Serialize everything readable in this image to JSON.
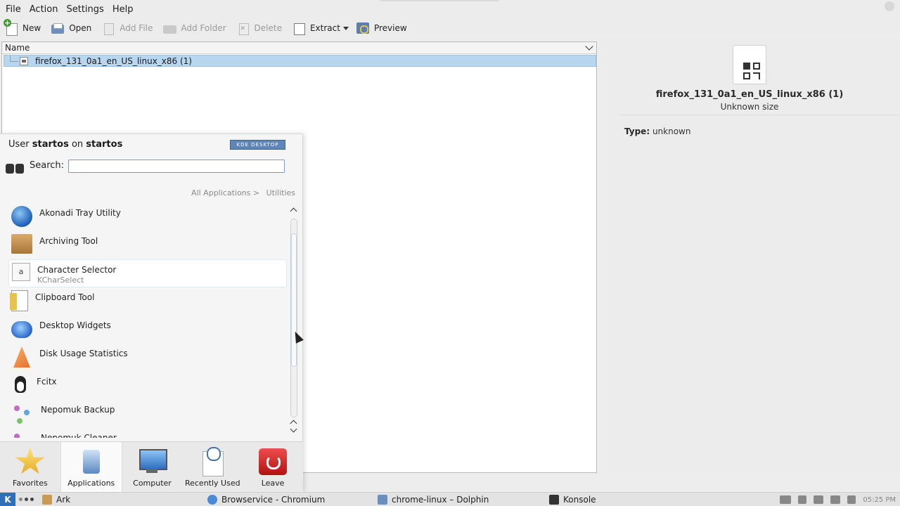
{
  "menubar": {
    "items": [
      "File",
      "Action",
      "Settings",
      "Help"
    ]
  },
  "toolbar": {
    "new": "New",
    "open": "Open",
    "add_file": "Add File",
    "add_folder": "Add Folder",
    "delete": "Delete",
    "extract": "Extract",
    "preview": "Preview"
  },
  "filelist": {
    "column_name": "Name",
    "rows": [
      {
        "name": "firefox_131_0a1_en_US_linux_x86 (1)"
      }
    ]
  },
  "info": {
    "title": "firefox_131_0a1_en_US_linux_x86 (1)",
    "size": "Unknown size",
    "type_label": "Type:",
    "type_value": "unknown"
  },
  "kickoff": {
    "user_prefix": "User",
    "user": "startos",
    "on": "on",
    "host": "startos",
    "badge": "KDE DESKTOP",
    "search_label": "Search:",
    "search_value": "",
    "crumb_root": "All Applications >",
    "crumb_current": "Utilities",
    "apps": [
      {
        "name": "Akonadi Tray Utility",
        "icon": "globe-icon"
      },
      {
        "name": "Archiving Tool",
        "icon": "box-icon"
      },
      {
        "name": "Character Selector",
        "sub": "KCharSelect",
        "icon": "char-icon"
      },
      {
        "name": "Clipboard Tool",
        "icon": "clipboard-icon"
      },
      {
        "name": "Desktop Widgets",
        "icon": "widgets-icon"
      },
      {
        "name": "Disk Usage Statistics",
        "icon": "disk-usage-icon"
      },
      {
        "name": "Fcitx",
        "icon": "penguin-icon"
      },
      {
        "name": "Nepomuk Backup",
        "icon": "nepomuk-icon"
      },
      {
        "name": "Nepomuk Cleaner",
        "icon": "nepomuk-icon"
      }
    ],
    "tabs": [
      "Favorites",
      "Applications",
      "Computer",
      "Recently Used",
      "Leave"
    ]
  },
  "taskbar": {
    "tasks": [
      "Ark",
      "Browservice - Chromium",
      "chrome-linux – Dolphin",
      "Konsole"
    ],
    "clock": "05:25 PM"
  }
}
